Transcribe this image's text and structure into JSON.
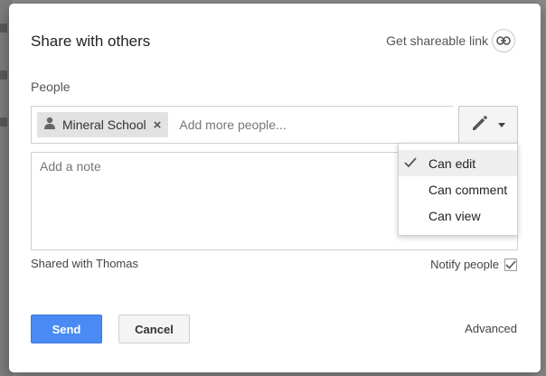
{
  "dialog": {
    "title": "Share with others",
    "shareable_link_label": "Get shareable link"
  },
  "people": {
    "label": "People",
    "chips": [
      {
        "label": "Mineral School",
        "icon": "person-icon",
        "remove_icon": "close-icon"
      }
    ],
    "input_placeholder": "Add more people...",
    "permission_button_icon": "pencil-icon"
  },
  "note": {
    "placeholder": "Add a note"
  },
  "permission_menu": {
    "items": [
      {
        "label": "Can edit",
        "selected": true
      },
      {
        "label": "Can comment",
        "selected": false
      },
      {
        "label": "Can view",
        "selected": false
      }
    ]
  },
  "footer": {
    "shared_with": "Shared with Thomas",
    "notify_label": "Notify people",
    "notify_checked": true,
    "send_label": "Send",
    "cancel_label": "Cancel",
    "advanced_label": "Advanced"
  },
  "colors": {
    "primary": "#4a8af4",
    "overlay": "#8a8a8a"
  }
}
